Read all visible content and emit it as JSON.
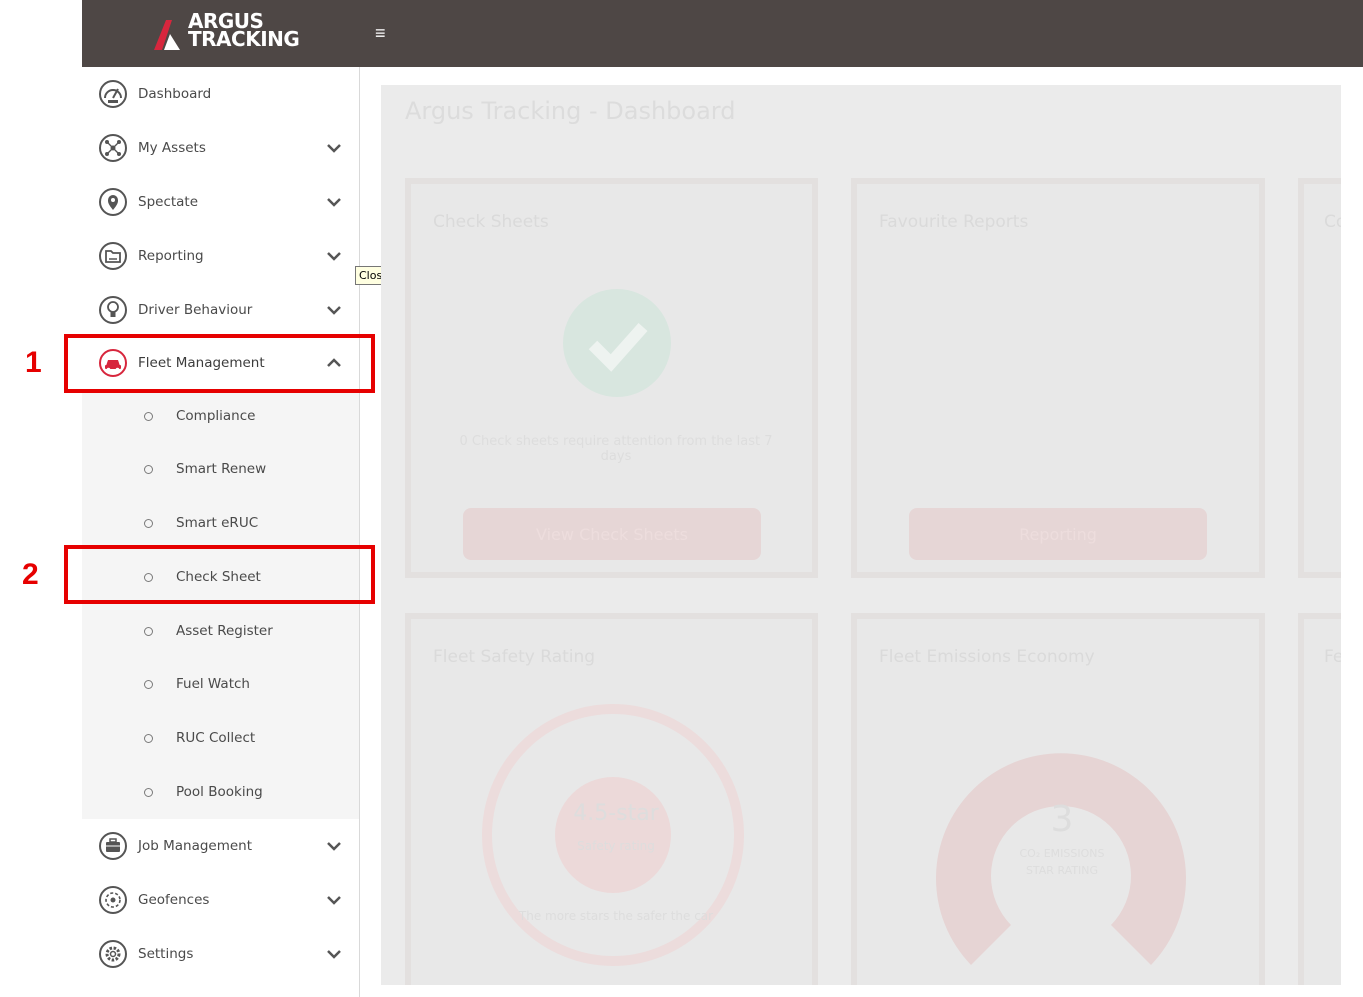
{
  "app": {
    "logo_line1": "ARGUS",
    "logo_line2": "TRACKING",
    "menu_icon": "hamburger-icon",
    "brand_color": "#4e4745",
    "accent_color": "#d7263d"
  },
  "sidebar": {
    "items": [
      {
        "label": "Dashboard",
        "icon": "dashboard-gauge-icon"
      },
      {
        "label": "My Assets",
        "icon": "assets-network-icon"
      },
      {
        "label": "Spectate",
        "icon": "location-pin-icon"
      },
      {
        "label": "Reporting",
        "icon": "reporting-folder-icon"
      },
      {
        "label": "Driver Behaviour",
        "icon": "lightbulb-icon"
      },
      {
        "label": "Fleet Management",
        "icon": "car-icon"
      },
      {
        "label": "Job Management",
        "icon": "briefcase-icon"
      },
      {
        "label": "Geofences",
        "icon": "geofence-icon"
      },
      {
        "label": "Settings",
        "icon": "gear-icon"
      }
    ],
    "fleet_submenu": [
      {
        "label": "Compliance"
      },
      {
        "label": "Smart Renew"
      },
      {
        "label": "Smart eRUC"
      },
      {
        "label": "Check Sheet"
      },
      {
        "label": "Asset Register"
      },
      {
        "label": "Fuel Watch"
      },
      {
        "label": "RUC Collect"
      },
      {
        "label": "Pool Booking"
      }
    ]
  },
  "tooltip": {
    "text": "Close"
  },
  "dashboard": {
    "title": "Argus Tracking - Dashboard",
    "cards": [
      {
        "title": "Check Sheets",
        "note": "0 Check sheets require attention from the last 7 days",
        "button": "View Check Sheets"
      },
      {
        "title": "Favourite Reports",
        "button": "Reporting"
      },
      {
        "title": "Fleet Safety Rating",
        "rating": "4.5-star",
        "rating_sub": "Safety rating",
        "ring_text": "The more stars the safer the car"
      },
      {
        "title": "Fleet Emissions Economy",
        "rating": "3",
        "rating_sub": "CO₂ EMISSIONS",
        "rating_sub2": "STAR RATING"
      }
    ],
    "partial_card_letters": [
      "Co",
      "Fe"
    ]
  },
  "annotations": [
    {
      "number": "1",
      "target": "Fleet Management"
    },
    {
      "number": "2",
      "target": "Check Sheet"
    }
  ]
}
